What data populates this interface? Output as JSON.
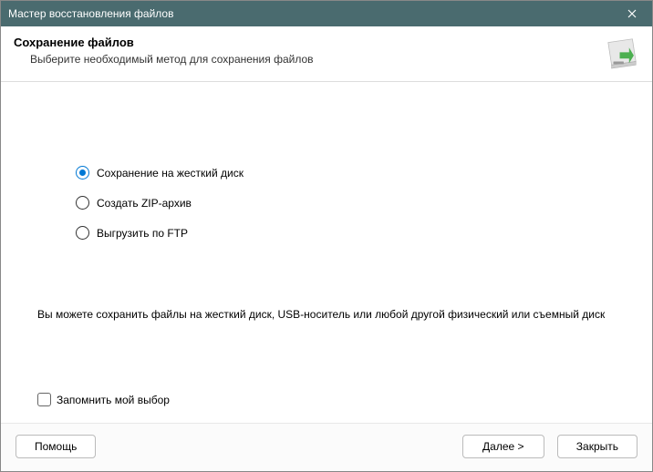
{
  "titlebar": {
    "title": "Мастер восстановления файлов"
  },
  "header": {
    "title": "Сохранение файлов",
    "subtitle": "Выберите необходимый метод для сохранения файлов"
  },
  "options": {
    "hdd": {
      "label": "Сохранение на жесткий диск",
      "selected": true
    },
    "zip": {
      "label": "Создать ZIP-архив",
      "selected": false
    },
    "ftp": {
      "label": "Выгрузить по FTP",
      "selected": false
    }
  },
  "description": "Вы можете сохранить файлы на жесткий диск, USB-носитель или любой другой физический или съемный диск",
  "remember": {
    "label": "Запомнить мой выбор",
    "checked": false
  },
  "footer": {
    "help": "Помощь",
    "next": "Далее >",
    "close": "Закрыть"
  }
}
